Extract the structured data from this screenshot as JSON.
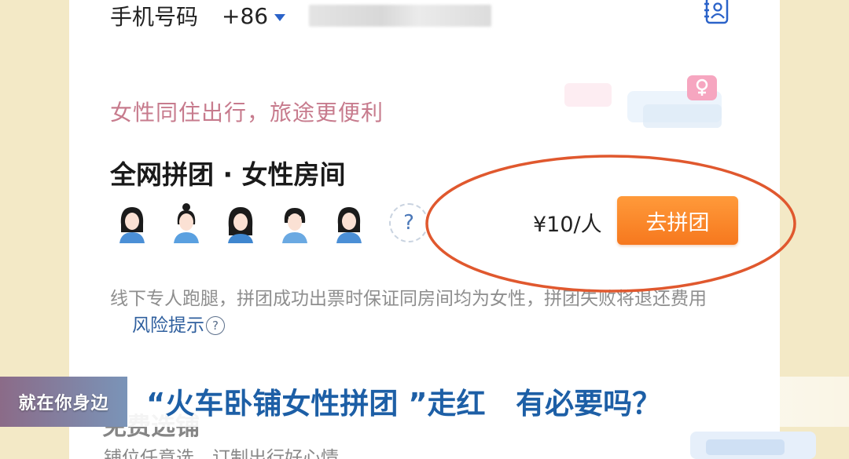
{
  "phone": {
    "label": "手机号码",
    "country_code": "+86",
    "icon": "contact-book-icon"
  },
  "promo": {
    "subtitle": "女性同住出行，旅途更便利",
    "title": "全网拼团 · 女性房间",
    "avatar_icons": [
      "female-avatar-icon",
      "female-avatar-icon",
      "female-avatar-icon",
      "female-avatar-icon",
      "female-avatar-icon"
    ],
    "unknown_slot": "?",
    "price": "¥10/人",
    "join_label": "去拼团",
    "description": "线下专人跑腿，拼团成功出票时保证同房间均为女性，拼团失败将退还费用",
    "risk_label": "风险提示",
    "risk_icon": "?"
  },
  "next_section": {
    "title": "免费选铺",
    "description": "铺位任意选，订制出行好心情"
  },
  "caption": {
    "tag": "就在你身边",
    "headline": "“火车卧铺女性拼团 ”走红   有必要吗？"
  },
  "colors": {
    "accent_orange": "#f6781e",
    "subtitle_pink": "#c77b8d",
    "link_blue": "#2f5f9e",
    "caption_blue": "#1d5fa6",
    "annotation_red": "#e0582e"
  }
}
